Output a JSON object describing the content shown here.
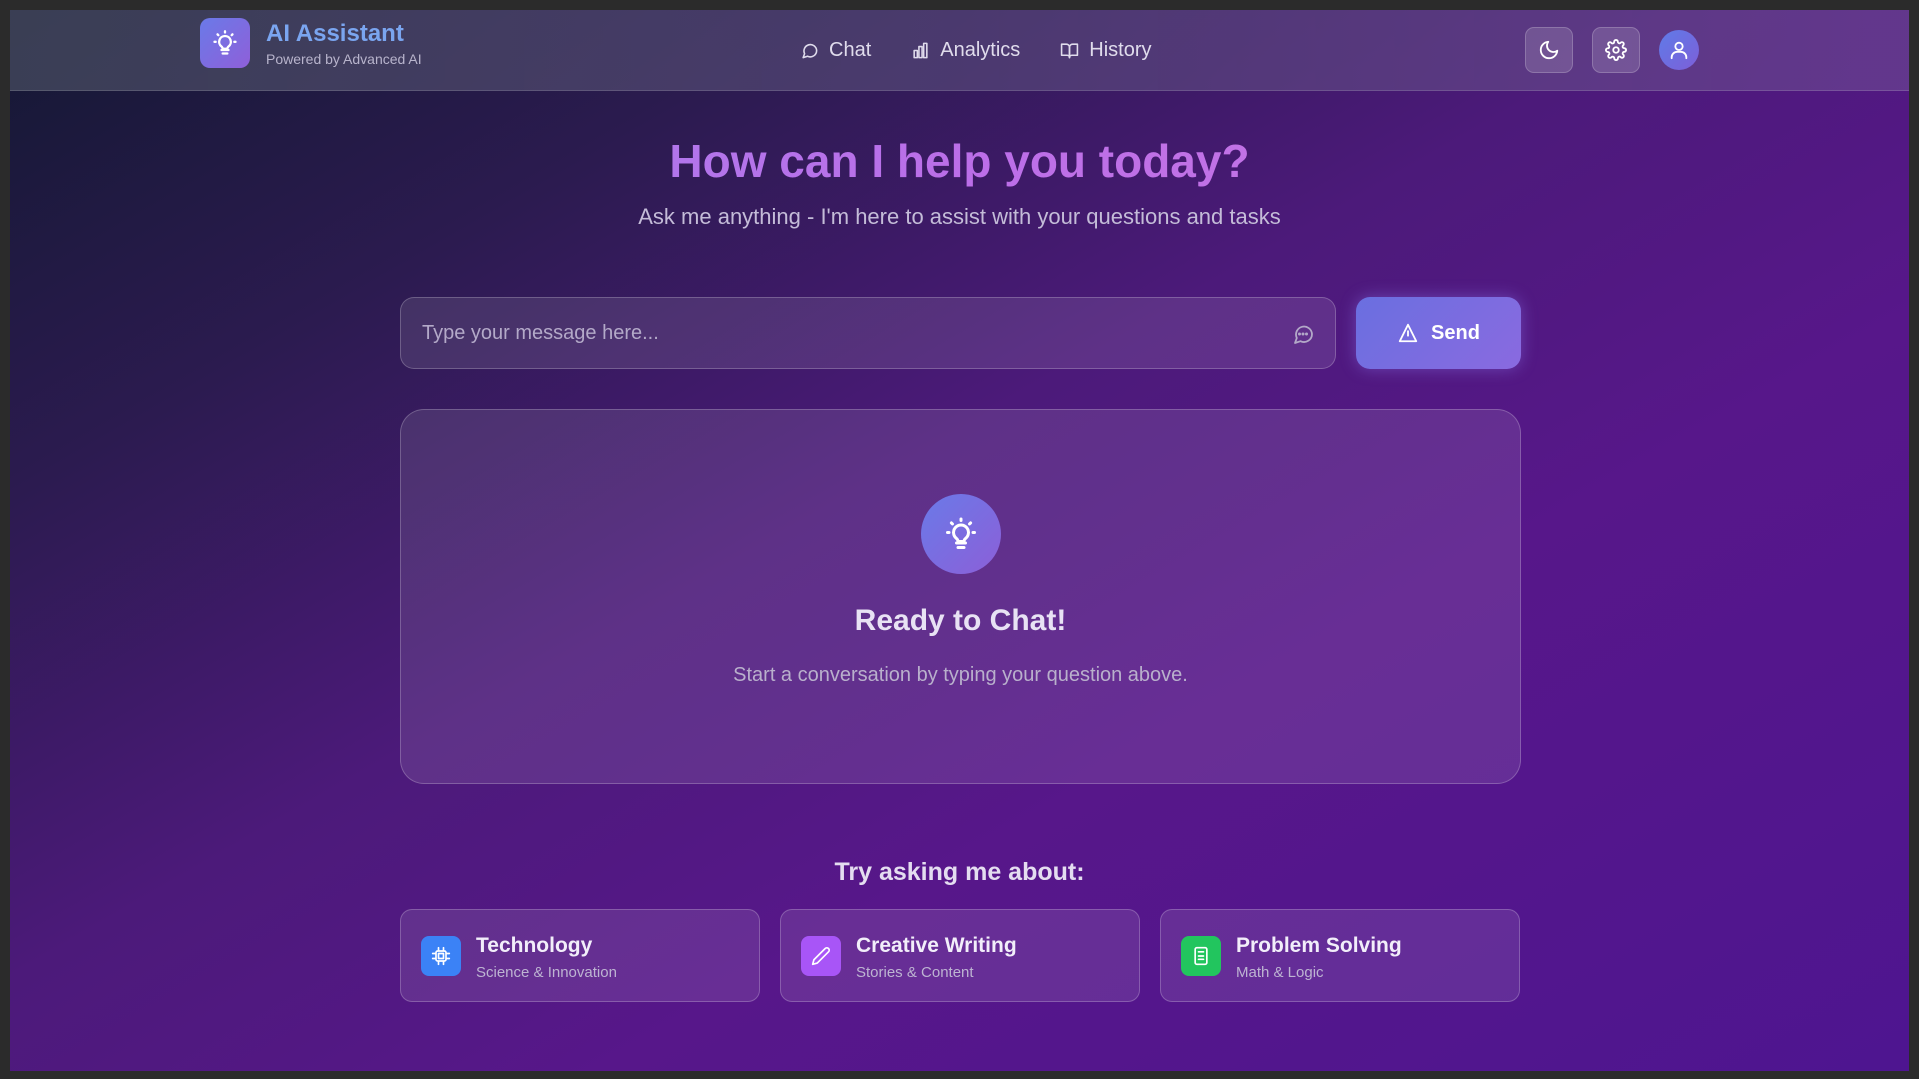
{
  "brand": {
    "title": "AI Assistant",
    "subtitle": "Powered by Advanced AI",
    "logo_icon": "lightbulb-icon"
  },
  "nav": {
    "items": [
      {
        "label": "Chat",
        "icon": "chat-bubble-icon"
      },
      {
        "label": "Analytics",
        "icon": "bar-chart-icon"
      },
      {
        "label": "History",
        "icon": "book-icon"
      }
    ]
  },
  "header_actions": {
    "theme_icon": "moon-icon",
    "settings_icon": "gear-icon",
    "profile_icon": "user-icon"
  },
  "hero": {
    "title": "How can I help you today?",
    "subtitle": "Ask me anything - I'm here to assist with your questions and tasks"
  },
  "composer": {
    "placeholder": "Type your message here...",
    "value": "",
    "send_label": "Send"
  },
  "empty_state": {
    "title": "Ready to Chat!",
    "subtitle": "Start a conversation by typing your question above."
  },
  "suggestions": {
    "heading": "Try asking me about:",
    "items": [
      {
        "title": "Technology",
        "subtitle": "Science & Innovation",
        "icon": "cpu-chip-icon",
        "color": "#3b82f6"
      },
      {
        "title": "Creative Writing",
        "subtitle": "Stories & Content",
        "icon": "pencil-icon",
        "color": "#a855f7"
      },
      {
        "title": "Problem Solving",
        "subtitle": "Math & Logic",
        "icon": "calculator-icon",
        "color": "#22c55e"
      }
    ]
  },
  "colors": {
    "accent": "#7c6ae6",
    "brand_title": "#7aa5f0"
  }
}
